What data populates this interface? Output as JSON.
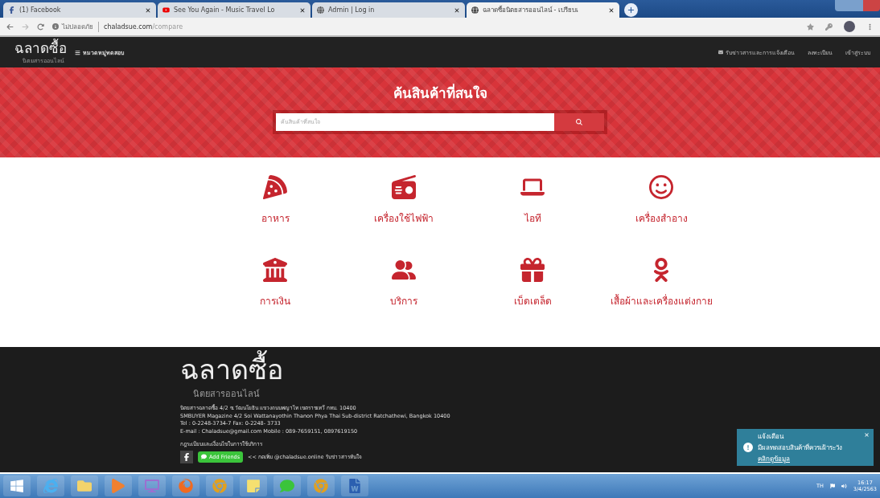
{
  "browser": {
    "tabs": [
      {
        "title": "(1) Facebook",
        "selected": false
      },
      {
        "title": "See You Again - Music Travel Lo",
        "selected": false
      },
      {
        "title": "Admin | Log in",
        "selected": false
      },
      {
        "title": "ฉลาดซื้อนิตยสารออนไลน์ - เปรียบเ",
        "selected": true
      }
    ],
    "security": "ไม่ปลอดภัย",
    "url_host": "chaladsue.com",
    "url_path": "/compare"
  },
  "site_nav": {
    "logo": "ฉลาดซื้อ",
    "logo_sub": "นิตยสารออนไลน์",
    "menu": "หมวดหมู่ทดสอบ",
    "links": [
      "รับข่าวสารและการแจ้งเตือน",
      "ลงทะเบียน",
      "เข้าสู่ระบบ"
    ]
  },
  "hero": {
    "title": "ค้นสินค้าที่สนใจ",
    "search_placeholder": "ค้นสินค้าที่สนใจ"
  },
  "categories": [
    {
      "label": "อาหาร",
      "kind": "pizza"
    },
    {
      "label": "เครื่องใช้ไฟฟ้า",
      "kind": "radio"
    },
    {
      "label": "ไอที",
      "kind": "laptop"
    },
    {
      "label": "เครื่องสำอาง",
      "kind": "face"
    },
    {
      "label": "การเงิน",
      "kind": "bank"
    },
    {
      "label": "บริการ",
      "kind": "people"
    },
    {
      "label": "เบ็ดเตล็ด",
      "kind": "gift"
    },
    {
      "label": "เสื้อผ้าและเครื่องแต่งกาย",
      "kind": "figure"
    }
  ],
  "footer": {
    "logo": "ฉลาดซื้อ",
    "logo_sub": "นิตยสารออนไลน์",
    "lines": [
      "นิตยสารฉลาดซื้อ 4/2 ซ.วัฒนโยธิน แขวงถนนพญาไท เขตราชเทวี กทม. 10400",
      "SMBUYER Magazine 4/2 Soi Wattanayothin Thanon Phya Thai Sub-district Ratchathewi, Bangkok 10400",
      "Tel : 0-2248-3734-7 Fax: 0-2248- 3733",
      "E-mail : Chaladsue@gmail.com Mobile : 089-7659151, 0897619150"
    ],
    "terms": "กฎระเบียบและเงื่อนไขในการใช้บริการ",
    "add_friends": "Add Friends",
    "line_note": "<< กดเพิ่ม @chaladsue.online รับข่าวสารทันใจ"
  },
  "notification": {
    "title": "แจ้งเตือน",
    "body": "มีผลทดสอบสินค้าที่ควรเฝ้าระวัง",
    "link": "คลิกดูข้อมูล"
  },
  "taskbar": {
    "lang": "TH",
    "time": "16:17",
    "date": "3/4/2563"
  }
}
